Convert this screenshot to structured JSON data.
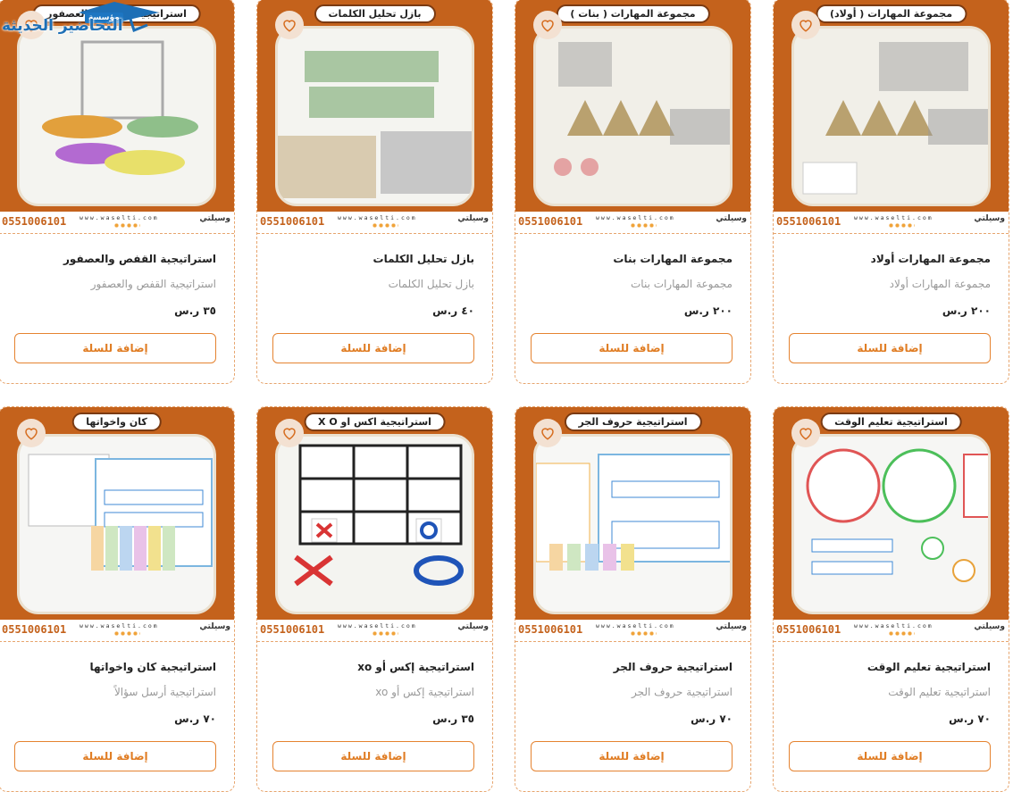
{
  "logo": {
    "line1": "مؤسسة",
    "line2": "التحاضير الحديثة"
  },
  "common": {
    "phone": "0551006101",
    "site": "www.waselti.com",
    "brand": "وسيلتي"
  },
  "products": [
    {
      "banner": "مجموعة المهارات ( أولاد)",
      "name": "مجموعة المهارات أولاد",
      "subtitle": "مجموعة المهارات أولاد",
      "price": "٢٠٠ ر.س",
      "button": "إضافة للسلة"
    },
    {
      "banner": "مجموعة المهارات ( بنات )",
      "name": "مجموعة المهارات بنات",
      "subtitle": "مجموعة المهارات بنات",
      "price": "٢٠٠ ر.س",
      "button": "إضافة للسلة"
    },
    {
      "banner": "بازل تحليل الكلمات",
      "name": "بازل تحليل الكلمات",
      "subtitle": "بازل تحليل الكلمات",
      "price": "٤٠ ر.س",
      "button": "إضافة للسلة"
    },
    {
      "banner": "استراتيجية القفص والعصفور",
      "name": "استراتيجية القفص والعصفور",
      "subtitle": "استراتيجية القفص والعصفور",
      "price": "٣٥ ر.س",
      "button": "إضافة للسلة"
    },
    {
      "banner": "استراتيجية تعليم الوقت",
      "name": "استراتيجية تعليم الوقت",
      "subtitle": "استراتيجية تعليم الوقت",
      "price": "٧٠ ر.س",
      "button": "إضافة للسلة"
    },
    {
      "banner": "استراتيجية حروف الجر",
      "name": "استراتيجية حروف الجر",
      "subtitle": "استراتيجية حروف الجر",
      "price": "٧٠ ر.س",
      "button": "إضافة للسلة"
    },
    {
      "banner": "استراتيجية اكس او X O",
      "name": "استراتيجية إكس أو xo",
      "subtitle": "استراتيجية إكس أو xo",
      "price": "٣٥ ر.س",
      "button": "إضافة للسلة"
    },
    {
      "banner": "كان واخواتها",
      "name": "استراتيجية كان واخواتها",
      "subtitle": "استراتيجية أرسل سؤالاً",
      "price": "٧٠ ر.س",
      "button": "إضافة للسلة"
    }
  ]
}
